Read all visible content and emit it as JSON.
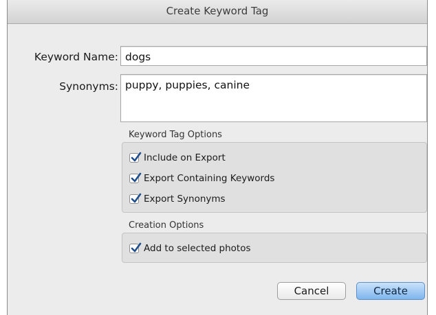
{
  "dialog": {
    "title": "Create Keyword Tag"
  },
  "fields": {
    "keyword_name_label": "Keyword Name:",
    "keyword_name_value": "dogs",
    "synonyms_label": "Synonyms:",
    "synonyms_value": "puppy, puppies, canine"
  },
  "keyword_tag_options": {
    "title": "Keyword Tag Options",
    "items": [
      {
        "label": "Include on Export",
        "checked": true
      },
      {
        "label": "Export Containing Keywords",
        "checked": true
      },
      {
        "label": "Export Synonyms",
        "checked": true
      }
    ]
  },
  "creation_options": {
    "title": "Creation Options",
    "items": [
      {
        "label": "Add to selected photos",
        "checked": true
      }
    ]
  },
  "buttons": {
    "cancel": "Cancel",
    "create": "Create"
  },
  "colors": {
    "accent_button": "#7fb5ec",
    "checkmark": "#1f4e8c"
  },
  "icons": {
    "checkbox": "checkmark-icon"
  }
}
